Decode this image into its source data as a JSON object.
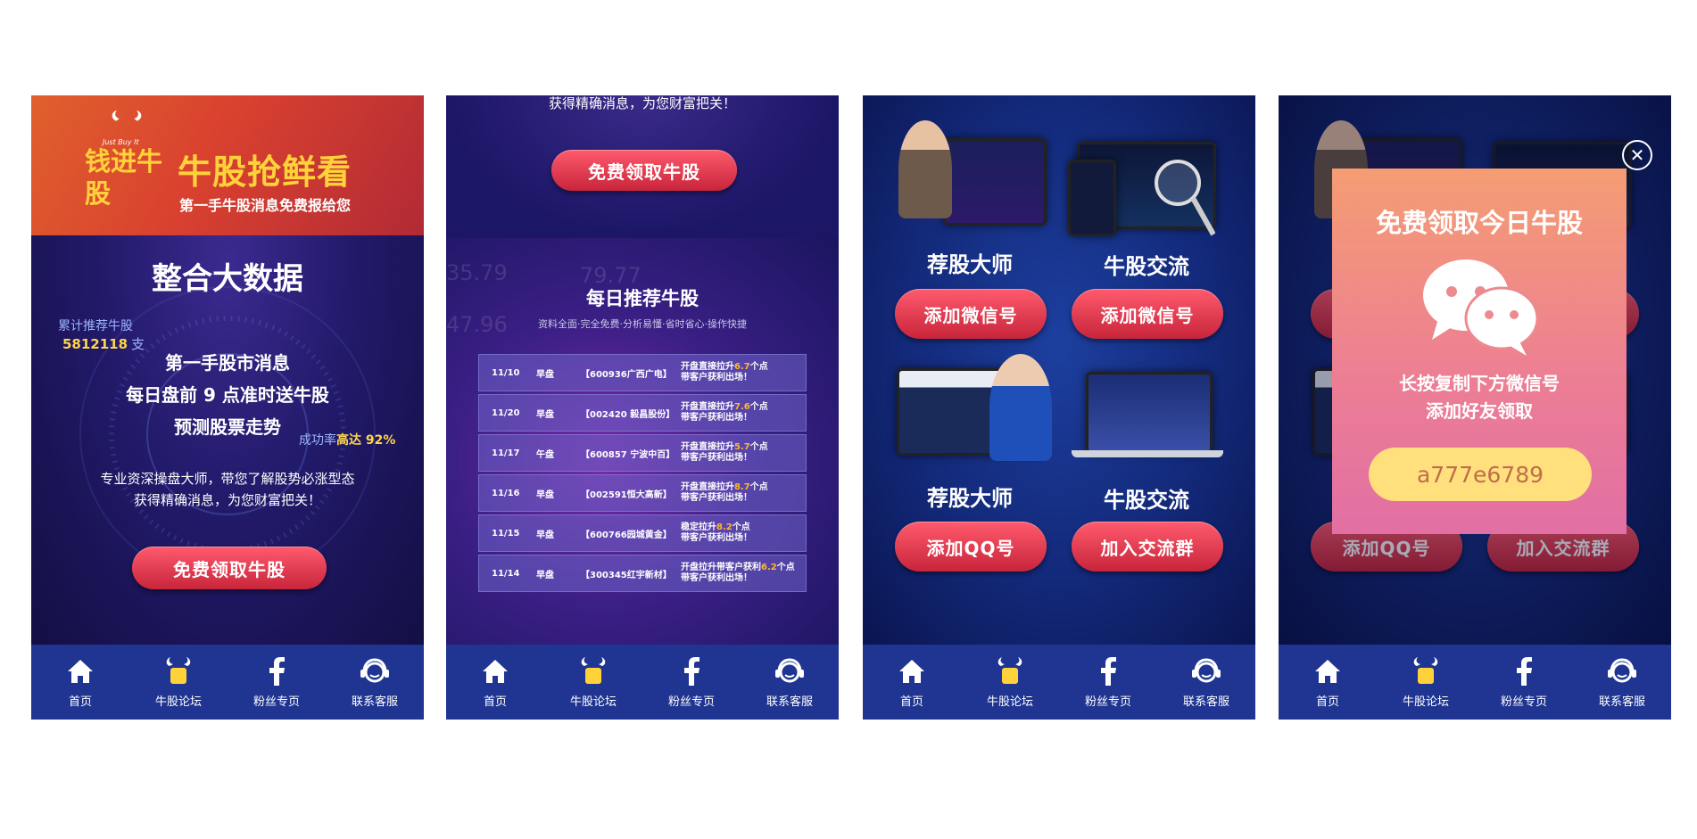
{
  "tabbar": [
    {
      "label": "首页",
      "icon": "home-icon"
    },
    {
      "label": "牛股论坛",
      "icon": "forum-logo-icon"
    },
    {
      "label": "粉丝专页",
      "icon": "facebook-icon"
    },
    {
      "label": "联系客服",
      "icon": "customer-service-icon"
    }
  ],
  "screen1": {
    "banner_logo_tag": "Just Buy It",
    "banner_brand": "钱进牛股",
    "banner_headline": "牛股抢鲜看",
    "banner_sub": "第一手牛股消息免费报给您",
    "title": "整合大数据",
    "stat_label": "累计推荐牛股",
    "stat_value": "5812118",
    "stat_unit": "支",
    "features": [
      "第一手股市消息",
      "每日盘前 9 点准时送牛股",
      "预测股票走势"
    ],
    "rate_label": "成功率",
    "rate_value": "高达 92%",
    "desc_line1": "专业资深操盘大师，带您了解股势必涨型态",
    "desc_line2": "获得精确消息，为您财富把关！",
    "cta": "免费领取牛股"
  },
  "screen2": {
    "desc_line2": "获得精确消息，为您财富把关！",
    "cta": "免费领取牛股",
    "ghost_numbers": [
      "35.79",
      "79.77",
      "47.96"
    ],
    "title": "每日推荐牛股",
    "subtitle": "资料全面·完全免费·分析易懂·省时省心·操作快捷",
    "rows": [
      {
        "date": "11/10",
        "session": "早盘",
        "code": "【600936广西广电】",
        "pre": "开盘直接拉升",
        "value": "6.7",
        "post": "个点",
        "line2": "带客户获利出场！"
      },
      {
        "date": "11/20",
        "session": "早盘",
        "code": "【002420 毅昌股份】",
        "pre": "开盘直接拉升",
        "value": "7.6",
        "post": "个点",
        "line2": "带客户获利出场！"
      },
      {
        "date": "11/17",
        "session": "午盘",
        "code": "【600857 宁波中百】",
        "pre": "开盘直接拉升",
        "value": "5.7",
        "post": "个点",
        "line2": "带客户获利出场！"
      },
      {
        "date": "11/16",
        "session": "早盘",
        "code": "【002591恒大高新】",
        "pre": "开盘直接拉升",
        "value": "8.7",
        "post": "个点",
        "line2": "带客户获利出场！"
      },
      {
        "date": "11/15",
        "session": "早盘",
        "code": "【600766园城黄金】",
        "pre": "稳定拉升",
        "value": "8.2",
        "post": "个点",
        "line2": "带客户获利出场！"
      },
      {
        "date": "11/14",
        "session": "早盘",
        "code": "【300345红宇新材】",
        "pre": "开盘拉升带客户获利",
        "value": "6.2",
        "post": "个点",
        "line2": "带客户获利出场！"
      }
    ]
  },
  "screen3": {
    "cards": [
      {
        "label": "荐股大师",
        "button": "添加微信号"
      },
      {
        "label": "牛股交流",
        "button": "添加微信号"
      },
      {
        "label": "荐股大师",
        "button": "添加QQ号"
      },
      {
        "label": "牛股交流",
        "button": "加入交流群"
      }
    ]
  },
  "screen4": {
    "modal_title": "免费领取今日牛股",
    "modal_line1": "长按复制下方微信号",
    "modal_line2": "添加好友领取",
    "wechat_id": "a777e6789",
    "bottom_buttons": [
      "添加QQ号",
      "加入交流群"
    ]
  },
  "colors": {
    "tabbar": "#1f3591",
    "accent_gold": "#ffd23a",
    "button_red": "#e0344b",
    "code_pill": "#ffe07c"
  }
}
